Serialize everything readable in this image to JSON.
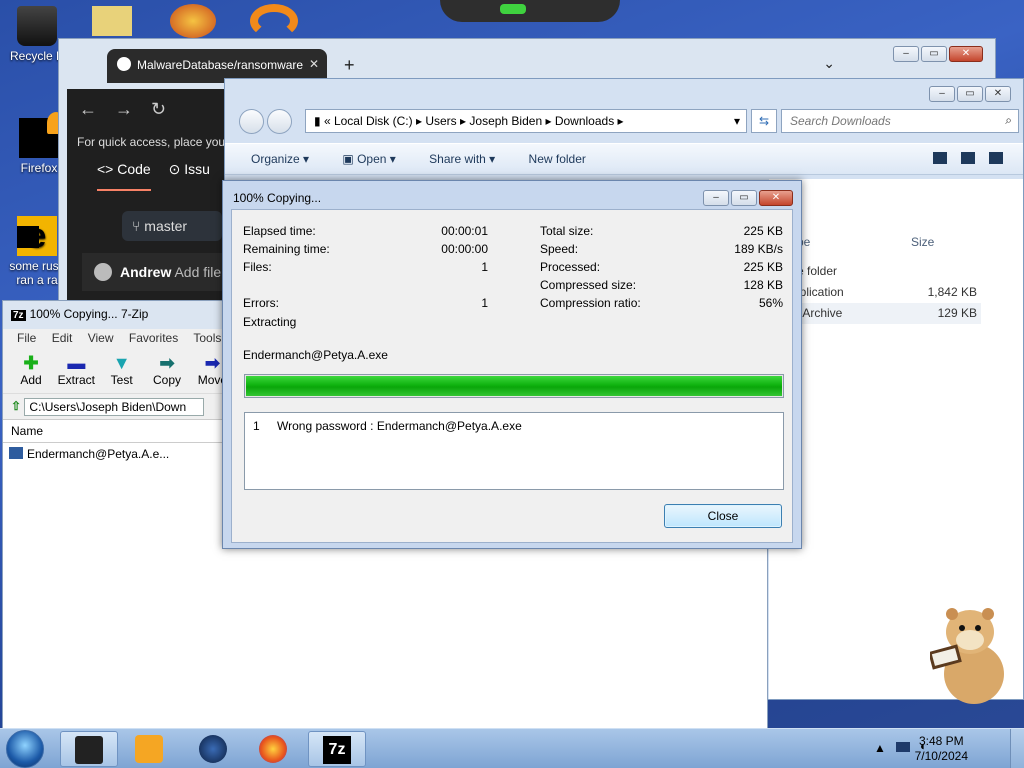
{
  "desktop": {
    "icons": [
      {
        "label": "Recycle B"
      },
      {
        "label": "Firefox"
      },
      {
        "label": "some russ"
      },
      {
        "label": "ran a ra"
      }
    ]
  },
  "browser": {
    "tab_title": "MalwareDatabase/ransomware",
    "tab_close": "✕",
    "new_tab": "+",
    "quick_access": "For quick access, place your",
    "code_tab": "Code",
    "issues_tab": "Issu",
    "branch": "master",
    "author": "Andrew",
    "add_file": "Add file"
  },
  "explorer": {
    "breadcrumb": [
      "Local Disk (C:)",
      "Users",
      "Joseph Biden",
      "Downloads"
    ],
    "search_placeholder": "Search Downloads",
    "toolbar": {
      "organize": "Organize",
      "open": "Open",
      "share_with": "Share with",
      "new_folder": "New folder"
    },
    "columns": {
      "type": "pe",
      "size": "Size"
    },
    "rows": [
      {
        "type": "e folder",
        "size": ""
      },
      {
        "type": "pplication",
        "size": "1,842 KB"
      },
      {
        "type": "p Archive",
        "size": "129 KB"
      }
    ]
  },
  "zip": {
    "title": "100% Copying... 7-Zip",
    "logo": "7z",
    "menu": [
      "File",
      "Edit",
      "View",
      "Favorites",
      "Tools"
    ],
    "tools": [
      {
        "label": "Add",
        "icon": "plus-icon"
      },
      {
        "label": "Extract",
        "icon": "minus-icon"
      },
      {
        "label": "Test",
        "icon": "check-icon"
      },
      {
        "label": "Copy",
        "icon": "copy-arrow-icon"
      },
      {
        "label": "Move",
        "icon": "move-arrow-icon"
      }
    ],
    "path": "C:\\Users\\Joseph Biden\\Down",
    "list_header": "Name",
    "items": [
      "Endermanch@Petya.A.e..."
    ]
  },
  "dialog": {
    "title": "100% Copying...",
    "left": [
      {
        "label": "Elapsed time:",
        "value": "00:00:01"
      },
      {
        "label": "Remaining time:",
        "value": "00:00:00"
      },
      {
        "label": "Files:",
        "value": "1"
      },
      {
        "label": "Errors:",
        "value": "1"
      }
    ],
    "right": [
      {
        "label": "Total size:",
        "value": "225 KB"
      },
      {
        "label": "Speed:",
        "value": "189 KB/s"
      },
      {
        "label": "Processed:",
        "value": "225 KB"
      },
      {
        "label": "Compressed size:",
        "value": "128 KB"
      },
      {
        "label": "Compression ratio:",
        "value": "56%"
      }
    ],
    "status": "Extracting",
    "current_file": "Endermanch@Petya.A.exe",
    "progress": 1.0,
    "messages": [
      {
        "num": "1",
        "text": "Wrong password : Endermanch@Petya.A.exe"
      }
    ],
    "close_button": "Close"
  },
  "taskbar": {
    "time": "3:48 PM",
    "date": "7/10/2024",
    "zip_label": "7z"
  },
  "colors": {
    "progress": "#0fb30f",
    "accent": "#3c7fb1"
  }
}
